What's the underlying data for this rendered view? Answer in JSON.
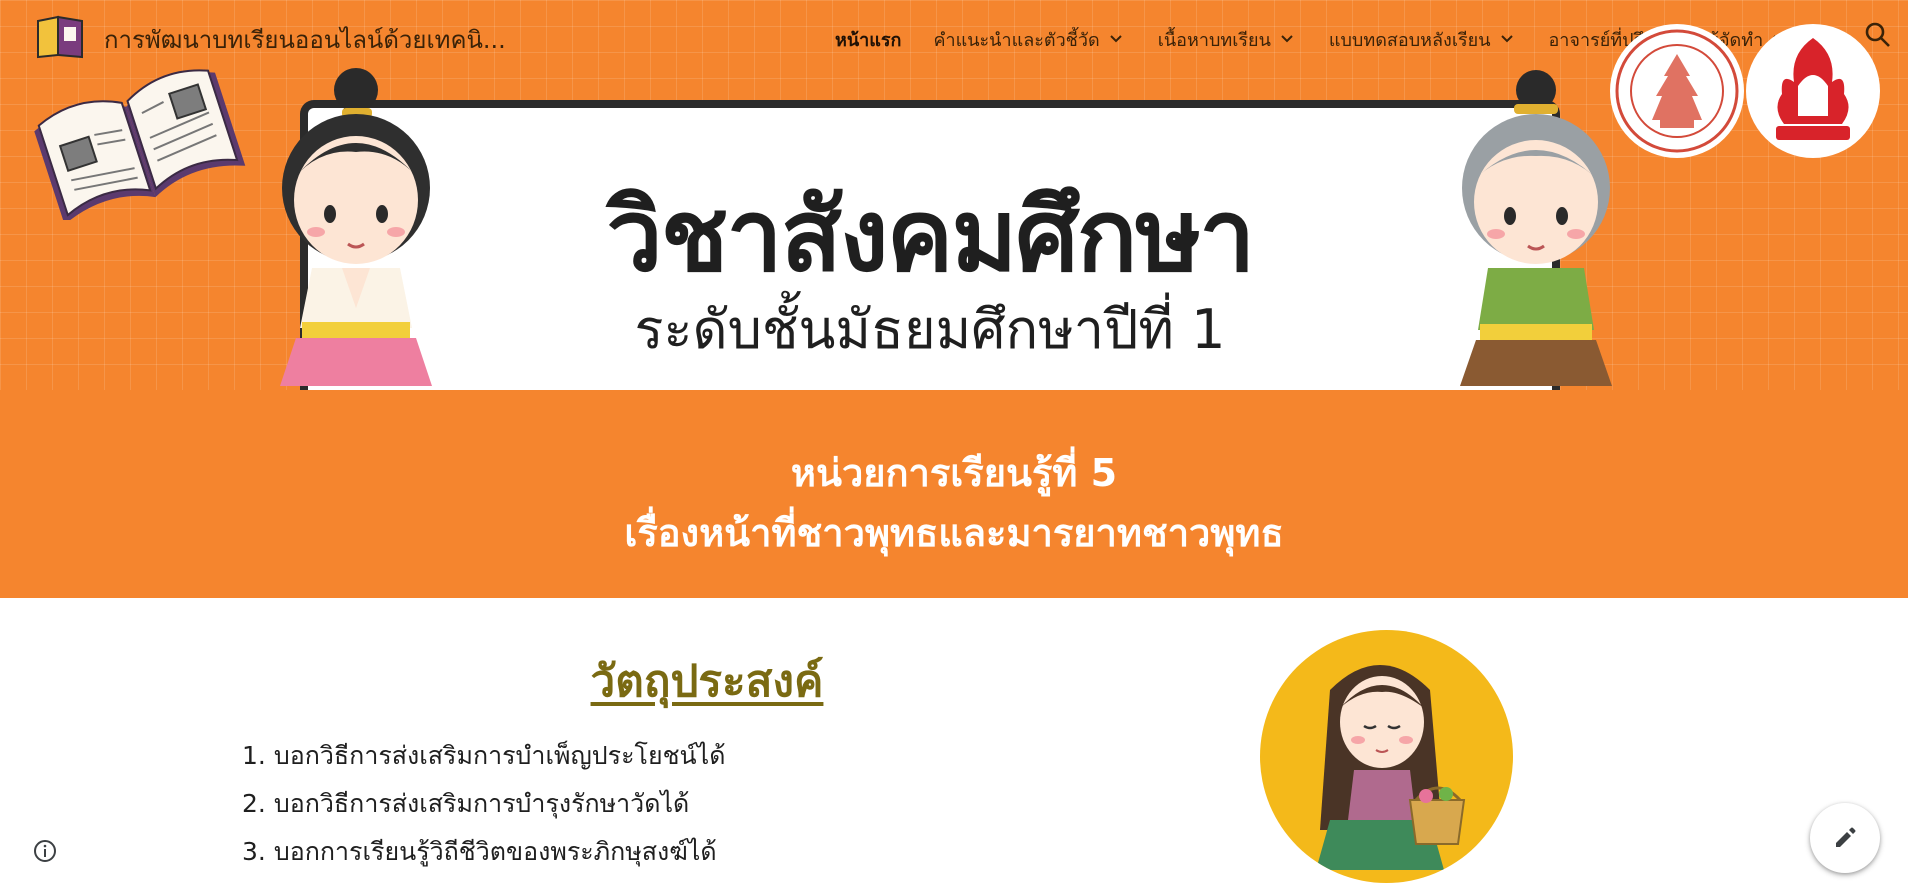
{
  "site": {
    "title": "การพัฒนาบทเรียนออนไลน์ด้วยเทคนิ..."
  },
  "nav": {
    "items": [
      {
        "label": "หน้าแรก",
        "active": true,
        "has_dropdown": false
      },
      {
        "label": "คำแนะนำและตัวชี้วัด",
        "active": false,
        "has_dropdown": true
      },
      {
        "label": "เนื้อหาบทเรียน",
        "active": false,
        "has_dropdown": true
      },
      {
        "label": "แบบทดสอบหลังเรียน",
        "active": false,
        "has_dropdown": true
      },
      {
        "label": "อาจารย์ที่ปรึกษาและผู้จัดทำ",
        "active": false,
        "has_dropdown": true
      }
    ]
  },
  "banner": {
    "title": "วิชาสังคมศึกษา",
    "subtitle": "ระดับชั้นมัธยมศึกษาปีที่ 1"
  },
  "unit": {
    "line1": "หน่วยการเรียนรู้ที่ 5",
    "line2": "เรื่องหน้าที่ชาวพุทธและมารยาทชาวพุทธ"
  },
  "objectives": {
    "heading": "วัตถุประสงค์",
    "items": [
      {
        "num": "1.",
        "text": "บอกวิธีการส่งเสริมการบำเพ็ญประโยชน์ได้"
      },
      {
        "num": "2.",
        "text": "บอกวิธีการส่งเสริมการบำรุงรักษาวัดได้"
      },
      {
        "num": "3.",
        "text": "บอกการเรียนรู้วิถีชีวิตของพระภิกษุสงฆ์ได้"
      }
    ]
  },
  "icons": {
    "site_logo": "book-icon",
    "search": "search-icon",
    "info": "info-icon",
    "edit": "pencil-icon",
    "dropdown": "chevron-down-icon"
  },
  "colors": {
    "brand_orange": "#f5852e",
    "nav_text": "#3a2208",
    "heading_olive": "#7a6a12",
    "circle_yellow": "#f4b91a",
    "unit_text": "#ffffff"
  }
}
